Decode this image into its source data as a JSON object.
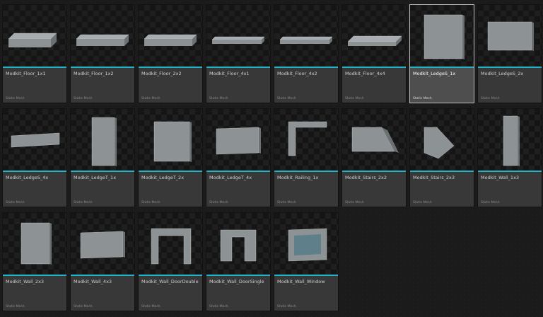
{
  "browser": {
    "selected_index": 6,
    "accent_color": "#1fb5c7",
    "assets": [
      {
        "name": "Modkit_Floor_1x1",
        "type": "Static Mesh",
        "shape": "slab-thick"
      },
      {
        "name": "Modkit_Floor_1x2",
        "type": "Static Mesh",
        "shape": "slab-med"
      },
      {
        "name": "Modkit_Floor_2x2",
        "type": "Static Mesh",
        "shape": "slab-med"
      },
      {
        "name": "Modkit_Floor_4x1",
        "type": "Static Mesh",
        "shape": "slab-thin"
      },
      {
        "name": "Modkit_Floor_4x2",
        "type": "Static Mesh",
        "shape": "slab-thin"
      },
      {
        "name": "Modkit_Floor_4x4",
        "type": "Static Mesh",
        "shape": "slab-wide"
      },
      {
        "name": "Modkit_LedgeS_1x",
        "type": "Static Mesh",
        "shape": "panel-tall"
      },
      {
        "name": "Modkit_LedgeS_2x",
        "type": "Static Mesh",
        "shape": "panel-wide"
      },
      {
        "name": "Modkit_LedgeS_4x",
        "type": "Static Mesh",
        "shape": "strip"
      },
      {
        "name": "Modkit_LedgeT_1x",
        "type": "Static Mesh",
        "shape": "panel-narrow"
      },
      {
        "name": "Modkit_LedgeT_2x",
        "type": "Static Mesh",
        "shape": "panel-square"
      },
      {
        "name": "Modkit_LedgeT_4x",
        "type": "Static Mesh",
        "shape": "panel-mid"
      },
      {
        "name": "Modkit_Railing_1x",
        "type": "Static Mesh",
        "shape": "railing"
      },
      {
        "name": "Modkit_Stairs_2x2",
        "type": "Static Mesh",
        "shape": "stairs-wide"
      },
      {
        "name": "Modkit_Stairs_2x3",
        "type": "Static Mesh",
        "shape": "stairs-narrow"
      },
      {
        "name": "Modkit_Wall_1x3",
        "type": "Static Mesh",
        "shape": "wall-thin"
      },
      {
        "name": "Modkit_Wall_2x3",
        "type": "Static Mesh",
        "shape": "panel-tall2"
      },
      {
        "name": "Modkit_Wall_4x3",
        "type": "Static Mesh",
        "shape": "panel-mid"
      },
      {
        "name": "Modkit_Wall_DoorDouble",
        "type": "Static Mesh",
        "shape": "door-double"
      },
      {
        "name": "Modkit_Wall_DoorSingle",
        "type": "Static Mesh",
        "shape": "door-single"
      },
      {
        "name": "Modkit_Wall_Window",
        "type": "Static Mesh",
        "shape": "window"
      }
    ]
  }
}
